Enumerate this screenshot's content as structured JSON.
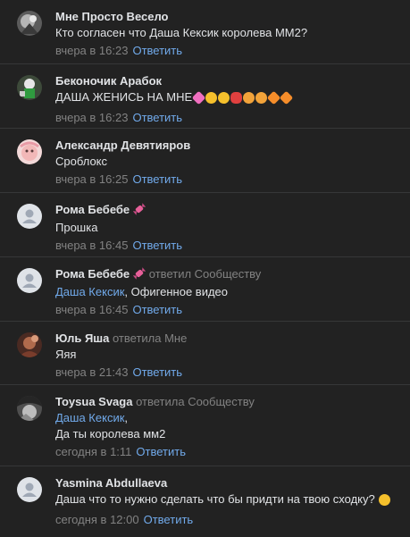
{
  "comments": [
    {
      "author": "Мне Просто Весело",
      "text": "Кто согласен что Даша Кексик королева ММ2?",
      "time": "вчера в 16:23",
      "reply_label": "Ответить"
    },
    {
      "author": "Беконочик Арабок",
      "text": "ДАША ЖЕНИСЬ НА МНЕ",
      "emoji_icons": [
        "pink-heart-icon",
        "tired-face-icon",
        "tired-face-icon",
        "kiss-lips-icon",
        "confounded-face-icon",
        "confounded-face-icon",
        "orange-heart-icon",
        "orange-heart-icon"
      ],
      "time": "вчера в 16:23",
      "reply_label": "Ответить"
    },
    {
      "author": "Александр Девятияров",
      "text": "Сроблокс",
      "time": "вчера в 16:25",
      "reply_label": "Ответить"
    },
    {
      "author": "Рома Бебебе",
      "badge_icon": "candy-badge-icon",
      "text": "Прошка",
      "time": "вчера в 16:45",
      "reply_label": "Ответить"
    },
    {
      "author": "Рома Бебебе",
      "badge_icon": "candy-badge-icon",
      "replied_to": "ответил Сообществу",
      "mention": "Даша Кексик",
      "text": ", Офигенное видео",
      "time": "вчера в 16:45",
      "reply_label": "Ответить"
    },
    {
      "author": "Юль Яша",
      "replied_to": "ответила Мне",
      "text": "Яяя",
      "time": "вчера в 21:43",
      "reply_label": "Ответить"
    },
    {
      "author": "Toysua Svaga",
      "replied_to": "ответила Сообществу",
      "mention": "Даша Кексик",
      "mention_suffix": ",",
      "text": "Да ты королева мм2",
      "time": "сегодня в 1:11",
      "reply_label": "Ответить"
    },
    {
      "author": "Yasmina Abdullaeva",
      "text": "Даша что то нужно сделать что бы придти на твою сходку?",
      "emoji_icons": [
        "thinking-face-icon"
      ],
      "time": "сегодня в 12:00",
      "reply_label": "Ответить"
    }
  ],
  "colors": {
    "background": "#222222",
    "link": "#71aaeb",
    "muted": "#828282",
    "text": "#e1e3e6"
  }
}
